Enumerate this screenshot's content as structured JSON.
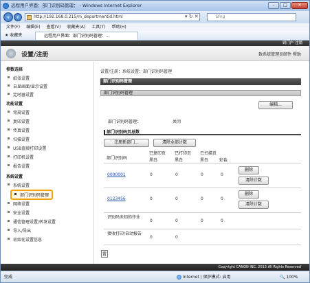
{
  "window": {
    "title": "远程用户界面：部门识别码管理： - Windows Internet Explorer",
    "minimize": "–",
    "maximize": "□",
    "close": "✕"
  },
  "address": {
    "url": "http://192.168.0.215/m_departmentid.html",
    "search_placeholder": "Bing"
  },
  "menu": [
    "文件(F)",
    "编辑(E)",
    "查看(V)",
    "收藏夹(A)",
    "工具(T)",
    "帮助(H)"
  ],
  "favbar": {
    "favorites": "收藏夹",
    "tab_title": "远程用户界面：部门识别码管理：..."
  },
  "topstrip": {
    "links": "到门户  注销"
  },
  "header": {
    "title": "设置/注册",
    "right": "致系统管理员邮件  帮助"
  },
  "sidebar": {
    "sections": [
      {
        "label": "参数选择",
        "items": [
          "纸张设置",
          "自显画面/显示设置",
          "定时器设置"
        ]
      },
      {
        "label": "功能设置",
        "items": [
          "常规设置",
          "复印设置",
          "传真设置",
          "扫描设置",
          "USB直接打印设置",
          "打印机设置",
          "报告设置"
        ]
      },
      {
        "label": "系统设置",
        "items": [
          "系统设置",
          "部门识别码管理",
          "网络设置",
          "安全设置",
          "通信管理设置/转发设置",
          "导入/导出",
          "初始化设置信息"
        ]
      }
    ]
  },
  "main": {
    "breadcrumb": "设置/注册：系统设置：部门识别码管理",
    "section_title": "部门识别码管理",
    "sub_title": "部门识别码管理",
    "edit_button": "编辑...",
    "status_label": "部门识别码管理：",
    "status_value": "关闭",
    "pages_title": "部门识别码页总数",
    "register_button": "注册新部门...",
    "clear_all_button": "清除全部计数",
    "col_id": "部门识别码",
    "col_copy": "已复印页",
    "col_print": "已打印页",
    "col_scan": "已扫描页",
    "bw": "黑白",
    "color": "彩色",
    "rows": [
      {
        "id": "0000001",
        "copy": "0",
        "print": "0",
        "scan_bw": "0",
        "scan_color": "0"
      },
      {
        "id": "0123456",
        "copy": "0",
        "print": "0",
        "scan_bw": "0",
        "scan_color": "0"
      }
    ],
    "delete_button": "删除",
    "clear_button": "清除计数",
    "unknown_label": "识别码未知的作业",
    "unknown_values": [
      "0",
      "0",
      "0",
      "0"
    ],
    "receive_label": "接收打印/自动报告",
    "receive_values": [
      "0",
      "0"
    ],
    "top_link": "置"
  },
  "footer": "Copyright CANON INC. 2013 All Rights Reserved",
  "status": {
    "done": "完成",
    "zone": "Internet | 保护模式: 启用",
    "zoom": "100%"
  }
}
